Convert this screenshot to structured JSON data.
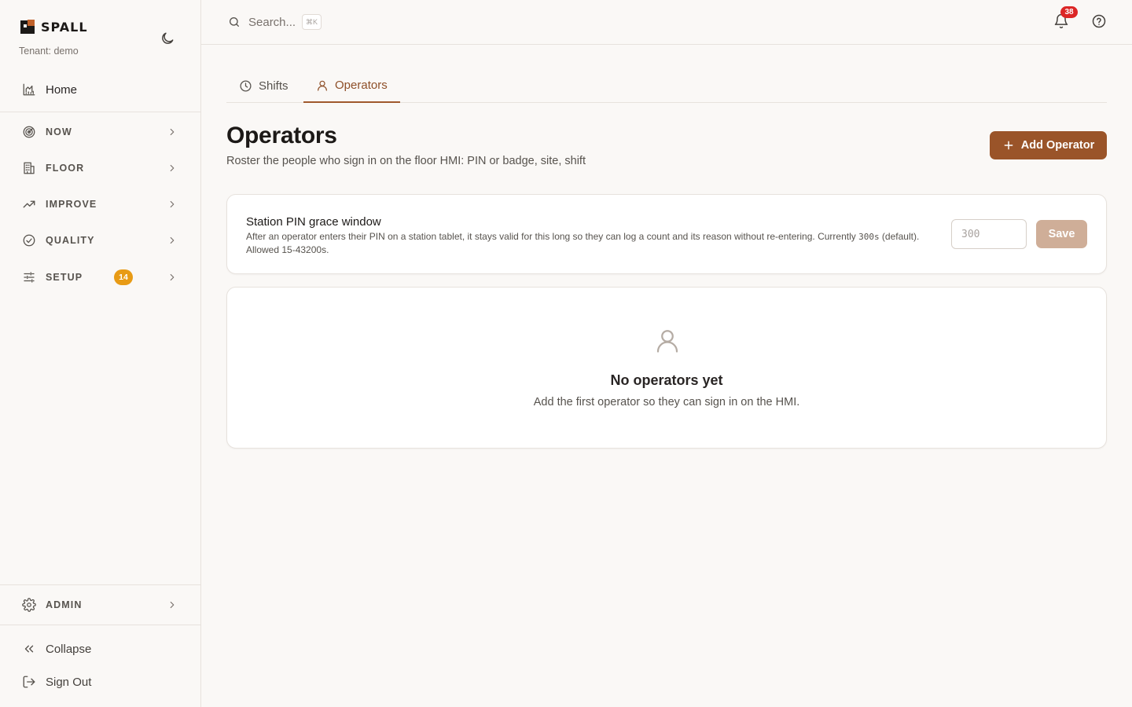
{
  "brand": {
    "name": "SPALL",
    "tenant": "Tenant: demo"
  },
  "sidebar": {
    "home": {
      "label": "Home",
      "icon": "chart-icon"
    },
    "groups": [
      {
        "label": "NOW",
        "icon": "radar-icon"
      },
      {
        "label": "FLOOR",
        "icon": "building-icon"
      },
      {
        "label": "IMPROVE",
        "icon": "trend-up-icon"
      },
      {
        "label": "QUALITY",
        "icon": "check-circle-icon"
      },
      {
        "label": "SETUP",
        "icon": "sliders-icon",
        "badge": "14"
      }
    ],
    "admin": {
      "label": "ADMIN",
      "icon": "gear-icon"
    },
    "collapse": {
      "label": "Collapse",
      "icon": "double-chevron-left-icon"
    },
    "signout": {
      "label": "Sign Out",
      "icon": "logout-icon"
    }
  },
  "topbar": {
    "search_placeholder": "Search...",
    "shortcut": "⌘K",
    "notifications_count": "38"
  },
  "tabs": [
    {
      "label": "Shifts",
      "icon": "clock-icon",
      "active": false
    },
    {
      "label": "Operators",
      "icon": "user-icon",
      "active": true
    }
  ],
  "page": {
    "title": "Operators",
    "subtitle": "Roster the people who sign in on the floor HMI: PIN or badge, site, shift",
    "add_button": "Add Operator"
  },
  "grace": {
    "title": "Station PIN grace window",
    "desc_before": "After an operator enters their PIN on a station tablet, it stays valid for this long so they can log a count and its reason without re-entering. Currently ",
    "current_value": "300s",
    "desc_after": " (default). Allowed 15-43200s.",
    "input_placeholder": "300",
    "save_label": "Save"
  },
  "empty_state": {
    "title": "No operators yet",
    "text": "Add the first operator so they can sign in on the HMI."
  },
  "colors": {
    "accent": "#9a5429",
    "accent_text": "#8e4f28",
    "save_disabled": "#cfae98",
    "badge_setup": "#e89b15",
    "badge_notify": "#dc2626"
  }
}
